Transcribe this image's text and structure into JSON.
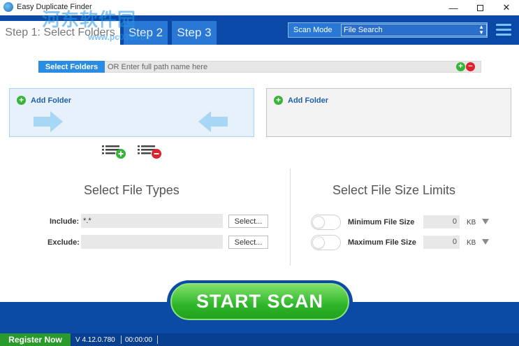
{
  "window": {
    "title": "Easy Duplicate Finder",
    "minimize_glyph": "—",
    "close_glyph": "✕"
  },
  "watermark": {
    "text": "河东软件园",
    "url": "www.pc0359.cn"
  },
  "steps": [
    {
      "label": "Step 1: Select Folders"
    },
    {
      "label": "Step 2"
    },
    {
      "label": "Step 3"
    }
  ],
  "scan_mode": {
    "label": "Scan Mode",
    "value": "File Search"
  },
  "path_bar": {
    "button_label": "Select Folders",
    "placeholder": "OR Enter full path name here",
    "add_glyph": "+",
    "remove_glyph": "−"
  },
  "folder_panels": {
    "left_label": "Add Folder",
    "right_label": "Add Folder",
    "plus_glyph": "+"
  },
  "file_types": {
    "title": "Select File Types",
    "include_label": "Include:",
    "include_value": "*.*",
    "exclude_label": "Exclude:",
    "exclude_value": "",
    "select_label": "Select..."
  },
  "size_limits": {
    "title": "Select File Size Limits",
    "min_label": "Minimum File Size",
    "min_value": "0",
    "max_label": "Maximum File Size",
    "max_value": "0",
    "unit": "KB"
  },
  "scan_button": "START SCAN",
  "status": {
    "register": "Register Now",
    "version": "V 4.12.0.780",
    "timer": "00:00:00"
  },
  "colors": {
    "header_blue": "#0a4aa6",
    "tab_blue": "#2a78d6",
    "accent_green": "#2fb62a",
    "remove_red": "#e0202a"
  },
  "icons": [
    "app-logo-icon",
    "minimize-icon",
    "maximize-icon",
    "close-icon",
    "menu-icon",
    "add-circle-icon",
    "remove-circle-icon",
    "arrow-right-icon",
    "arrow-left-icon",
    "list-add-icon",
    "list-remove-icon",
    "dropdown-arrow-icon"
  ]
}
